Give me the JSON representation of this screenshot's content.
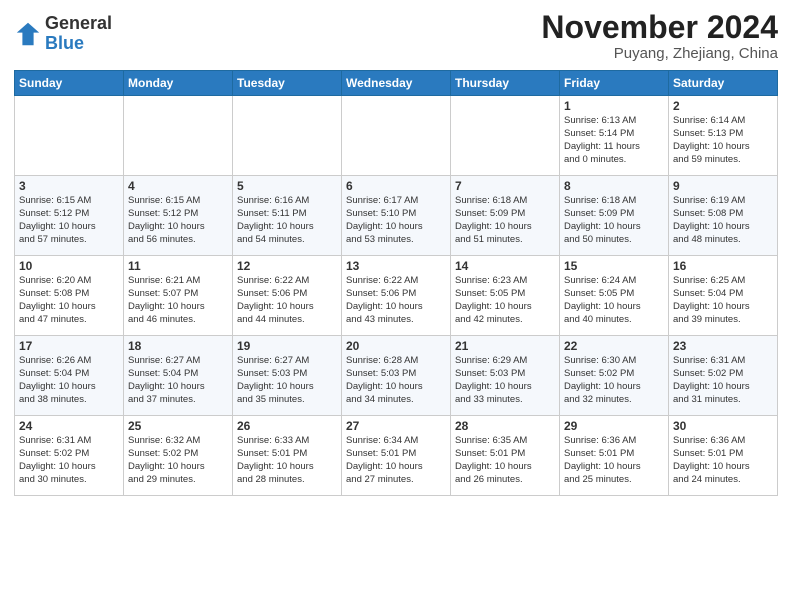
{
  "header": {
    "logo_general": "General",
    "logo_blue": "Blue",
    "month_title": "November 2024",
    "subtitle": "Puyang, Zhejiang, China"
  },
  "calendar": {
    "headers": [
      "Sunday",
      "Monday",
      "Tuesday",
      "Wednesday",
      "Thursday",
      "Friday",
      "Saturday"
    ],
    "weeks": [
      [
        {
          "day": "",
          "info": ""
        },
        {
          "day": "",
          "info": ""
        },
        {
          "day": "",
          "info": ""
        },
        {
          "day": "",
          "info": ""
        },
        {
          "day": "",
          "info": ""
        },
        {
          "day": "1",
          "info": "Sunrise: 6:13 AM\nSunset: 5:14 PM\nDaylight: 11 hours\nand 0 minutes."
        },
        {
          "day": "2",
          "info": "Sunrise: 6:14 AM\nSunset: 5:13 PM\nDaylight: 10 hours\nand 59 minutes."
        }
      ],
      [
        {
          "day": "3",
          "info": "Sunrise: 6:15 AM\nSunset: 5:12 PM\nDaylight: 10 hours\nand 57 minutes."
        },
        {
          "day": "4",
          "info": "Sunrise: 6:15 AM\nSunset: 5:12 PM\nDaylight: 10 hours\nand 56 minutes."
        },
        {
          "day": "5",
          "info": "Sunrise: 6:16 AM\nSunset: 5:11 PM\nDaylight: 10 hours\nand 54 minutes."
        },
        {
          "day": "6",
          "info": "Sunrise: 6:17 AM\nSunset: 5:10 PM\nDaylight: 10 hours\nand 53 minutes."
        },
        {
          "day": "7",
          "info": "Sunrise: 6:18 AM\nSunset: 5:09 PM\nDaylight: 10 hours\nand 51 minutes."
        },
        {
          "day": "8",
          "info": "Sunrise: 6:18 AM\nSunset: 5:09 PM\nDaylight: 10 hours\nand 50 minutes."
        },
        {
          "day": "9",
          "info": "Sunrise: 6:19 AM\nSunset: 5:08 PM\nDaylight: 10 hours\nand 48 minutes."
        }
      ],
      [
        {
          "day": "10",
          "info": "Sunrise: 6:20 AM\nSunset: 5:08 PM\nDaylight: 10 hours\nand 47 minutes."
        },
        {
          "day": "11",
          "info": "Sunrise: 6:21 AM\nSunset: 5:07 PM\nDaylight: 10 hours\nand 46 minutes."
        },
        {
          "day": "12",
          "info": "Sunrise: 6:22 AM\nSunset: 5:06 PM\nDaylight: 10 hours\nand 44 minutes."
        },
        {
          "day": "13",
          "info": "Sunrise: 6:22 AM\nSunset: 5:06 PM\nDaylight: 10 hours\nand 43 minutes."
        },
        {
          "day": "14",
          "info": "Sunrise: 6:23 AM\nSunset: 5:05 PM\nDaylight: 10 hours\nand 42 minutes."
        },
        {
          "day": "15",
          "info": "Sunrise: 6:24 AM\nSunset: 5:05 PM\nDaylight: 10 hours\nand 40 minutes."
        },
        {
          "day": "16",
          "info": "Sunrise: 6:25 AM\nSunset: 5:04 PM\nDaylight: 10 hours\nand 39 minutes."
        }
      ],
      [
        {
          "day": "17",
          "info": "Sunrise: 6:26 AM\nSunset: 5:04 PM\nDaylight: 10 hours\nand 38 minutes."
        },
        {
          "day": "18",
          "info": "Sunrise: 6:27 AM\nSunset: 5:04 PM\nDaylight: 10 hours\nand 37 minutes."
        },
        {
          "day": "19",
          "info": "Sunrise: 6:27 AM\nSunset: 5:03 PM\nDaylight: 10 hours\nand 35 minutes."
        },
        {
          "day": "20",
          "info": "Sunrise: 6:28 AM\nSunset: 5:03 PM\nDaylight: 10 hours\nand 34 minutes."
        },
        {
          "day": "21",
          "info": "Sunrise: 6:29 AM\nSunset: 5:03 PM\nDaylight: 10 hours\nand 33 minutes."
        },
        {
          "day": "22",
          "info": "Sunrise: 6:30 AM\nSunset: 5:02 PM\nDaylight: 10 hours\nand 32 minutes."
        },
        {
          "day": "23",
          "info": "Sunrise: 6:31 AM\nSunset: 5:02 PM\nDaylight: 10 hours\nand 31 minutes."
        }
      ],
      [
        {
          "day": "24",
          "info": "Sunrise: 6:31 AM\nSunset: 5:02 PM\nDaylight: 10 hours\nand 30 minutes."
        },
        {
          "day": "25",
          "info": "Sunrise: 6:32 AM\nSunset: 5:02 PM\nDaylight: 10 hours\nand 29 minutes."
        },
        {
          "day": "26",
          "info": "Sunrise: 6:33 AM\nSunset: 5:01 PM\nDaylight: 10 hours\nand 28 minutes."
        },
        {
          "day": "27",
          "info": "Sunrise: 6:34 AM\nSunset: 5:01 PM\nDaylight: 10 hours\nand 27 minutes."
        },
        {
          "day": "28",
          "info": "Sunrise: 6:35 AM\nSunset: 5:01 PM\nDaylight: 10 hours\nand 26 minutes."
        },
        {
          "day": "29",
          "info": "Sunrise: 6:36 AM\nSunset: 5:01 PM\nDaylight: 10 hours\nand 25 minutes."
        },
        {
          "day": "30",
          "info": "Sunrise: 6:36 AM\nSunset: 5:01 PM\nDaylight: 10 hours\nand 24 minutes."
        }
      ]
    ]
  }
}
